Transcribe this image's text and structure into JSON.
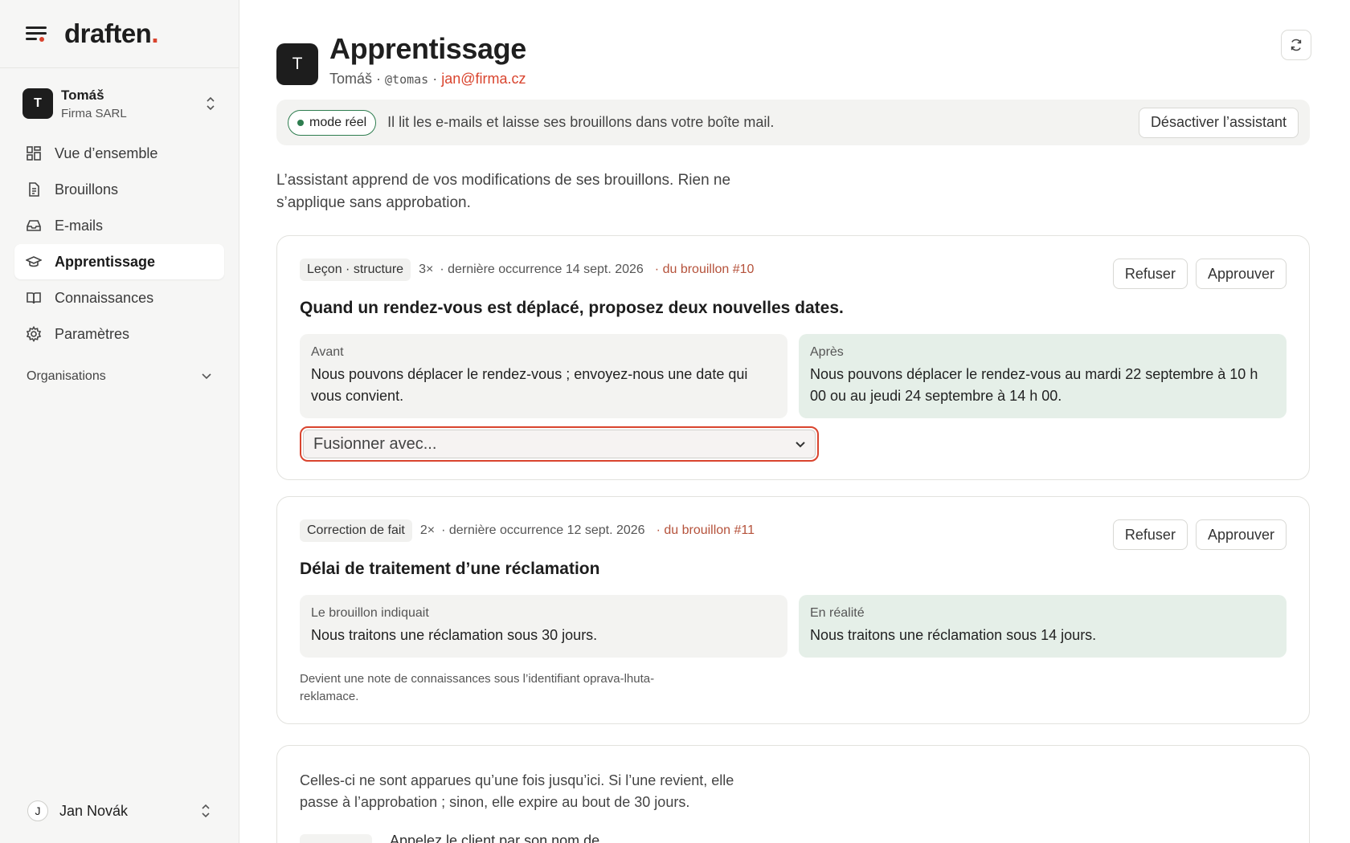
{
  "app": {
    "logo_text": "draften",
    "logo_dot": "."
  },
  "account": {
    "initial": "T",
    "name": "Tomáš",
    "org": "Firma SARL"
  },
  "nav": [
    {
      "label": "Vue d’ensemble",
      "icon": "grid-icon",
      "active": false
    },
    {
      "label": "Brouillons",
      "icon": "document-icon",
      "active": false
    },
    {
      "label": "E-mails",
      "icon": "inbox-icon",
      "active": false
    },
    {
      "label": "Apprentissage",
      "icon": "graduation-cap-icon",
      "active": true
    },
    {
      "label": "Connaissances",
      "icon": "book-icon",
      "active": false
    },
    {
      "label": "Paramètres",
      "icon": "gear-icon",
      "active": false
    }
  ],
  "organisations_label": "Organisations",
  "user": {
    "initial": "J",
    "name": "Jan Novák"
  },
  "header": {
    "initial": "T",
    "title": "Apprentissage",
    "name": "Tomáš",
    "handle": "@tomas",
    "email": "jan@firma.cz"
  },
  "mode": {
    "badge": "mode réel",
    "description": "Il lit les e-mails et laisse ses brouillons dans votre boîte mail.",
    "deactivate_label": "Désactiver l’assistant"
  },
  "intro": "L’assistant apprend de vos modifications de ses brouillons. Rien ne s’applique sans approbation.",
  "lessons": [
    {
      "tag": "Leçon · structure",
      "count": "3×",
      "last": "· dernière occurrence 14 sept. 2026",
      "source": "· du brouillon #10",
      "title": "Quand un rendez-vous est déplacé, proposez deux nouvelles dates.",
      "left_label": "Avant",
      "left_text": "Nous pouvons déplacer le rendez-vous ; envoyez-nous une date qui vous convient.",
      "right_label": "Après",
      "right_text": "Nous pouvons déplacer le rendez-vous au mardi 22 septembre à 10 h 00 ou au jeudi 24 septembre à 14 h 00.",
      "merge_placeholder": "Fusionner avec...",
      "reject": "Refuser",
      "approve": "Approuver"
    },
    {
      "tag": "Correction de fait",
      "count": "2×",
      "last": "· dernière occurrence 12 sept. 2026",
      "source": "· du brouillon #11",
      "title": "Délai de traitement d’une réclamation",
      "left_label": "Le brouillon indiquait",
      "left_text": "Nous traitons une réclamation sous 30 jours.",
      "right_label": "En réalité",
      "right_text": "Nous traitons une réclamation sous 14 jours.",
      "note": "Devient une note de connaissances sous l’identifiant oprava-lhuta-reklamace.",
      "reject": "Refuser",
      "approve": "Approuver"
    }
  ],
  "pending": {
    "text": "Celles-ci ne sont apparues qu’une fois jusqu’ici. Si l’une revient, elle passe à l’approbation ; sinon, elle expire au bout de 30 jours.",
    "first_item": "Appelez le client par son nom de"
  }
}
